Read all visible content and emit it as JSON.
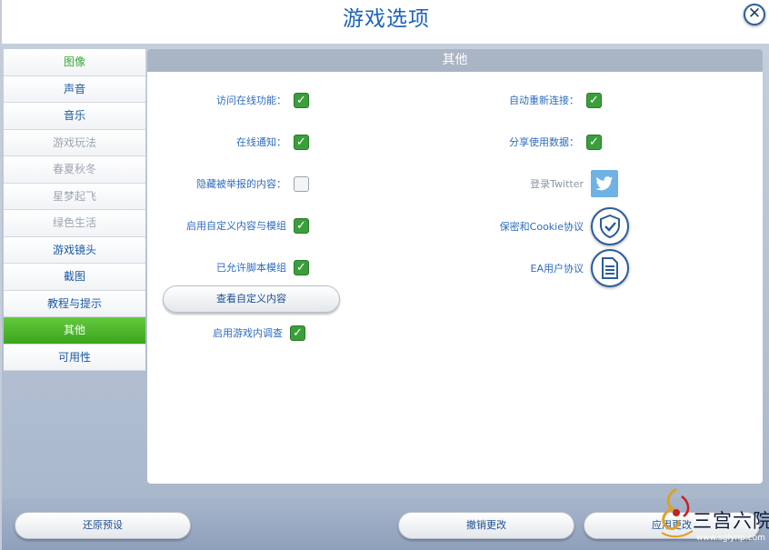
{
  "window": {
    "title": "游戏选项"
  },
  "sidebar": {
    "items": [
      {
        "label": "图像"
      },
      {
        "label": "声音"
      },
      {
        "label": "音乐"
      },
      {
        "label": "游戏玩法"
      },
      {
        "label": "春夏秋冬"
      },
      {
        "label": "星梦起飞"
      },
      {
        "label": "绿色生活"
      },
      {
        "label": "游戏镜头"
      },
      {
        "label": "截图"
      },
      {
        "label": "教程与提示"
      },
      {
        "label": "其他"
      },
      {
        "label": "可用性"
      }
    ],
    "active": "其他"
  },
  "panel": {
    "header": "其他",
    "left_options": [
      {
        "label": "访问在线功能：",
        "checked": true
      },
      {
        "label": "在线通知：",
        "checked": true
      },
      {
        "label": "隐藏被举报的内容：",
        "checked": false
      },
      {
        "label": "启用自定义内容与模组",
        "checked": true
      },
      {
        "label": "已允许脚本模组",
        "checked": true
      }
    ],
    "view_custom_button": "查看自定义内容",
    "survey_option": {
      "label": "启用游戏内调查",
      "checked": true
    },
    "right_options": [
      {
        "label": "自动重新连接：",
        "checked": true
      },
      {
        "label": "分享使用数据：",
        "checked": true
      }
    ],
    "twitter_label": "登录Twitter",
    "privacy_label": "保密和Cookie协议",
    "eula_label": "EA用户协议"
  },
  "bottom": {
    "restore_defaults": "还原预设",
    "cancel_changes": "撤销更改",
    "apply_changes": "应用更改"
  },
  "watermark": {
    "text": "三宫六院",
    "url": "www.sglynp.com"
  },
  "colors": {
    "accent_blue": "#1c63b8",
    "active_green": "#3ba51e",
    "check_green": "#3a9f3a",
    "frame": "#aab8cc"
  }
}
